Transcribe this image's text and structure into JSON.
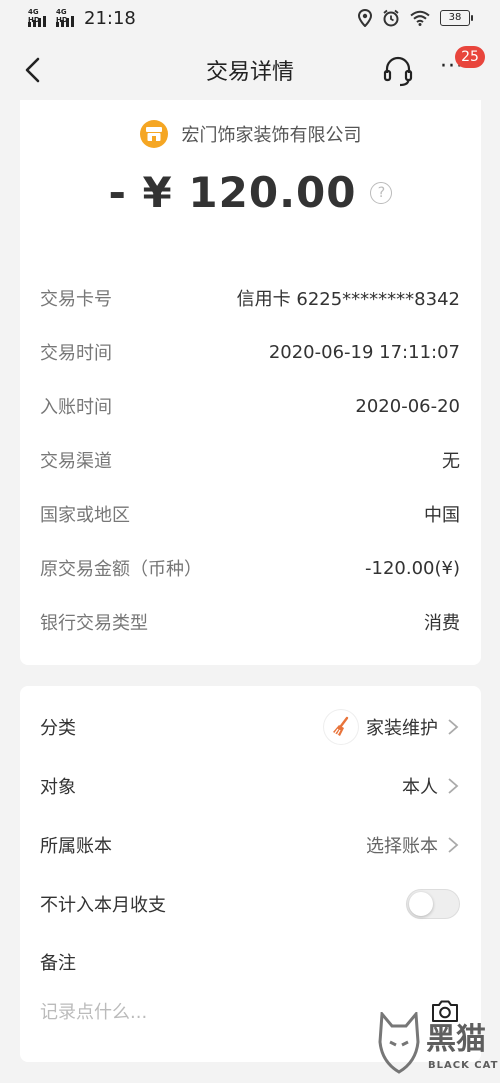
{
  "status_bar": {
    "signal1_tag": "4G HD",
    "signal2_tag": "4G HD",
    "time": "21:18",
    "battery": "38"
  },
  "nav": {
    "title": "交易详情",
    "more_label": "···",
    "badge_count": "25"
  },
  "transaction": {
    "merchant": "宏门饰家装饰有限公司",
    "amount": "- ¥ 120.00",
    "help_glyph": "?",
    "details": [
      {
        "label": "交易卡号",
        "value": "信用卡 6225********8342"
      },
      {
        "label": "交易时间",
        "value": "2020-06-19 17:11:07"
      },
      {
        "label": "入账时间",
        "value": "2020-06-20"
      },
      {
        "label": "交易渠道",
        "value": "无"
      },
      {
        "label": "国家或地区",
        "value": "中国"
      },
      {
        "label": "原交易金额（币种）",
        "value": "-120.00(¥)"
      },
      {
        "label": "银行交易类型",
        "value": "消费"
      }
    ]
  },
  "bookkeeping": {
    "category_label": "分类",
    "category_value": "家装维护",
    "target_label": "对象",
    "target_value": "本人",
    "account_label": "所属账本",
    "account_value": "选择账本",
    "exclude_label": "不计入本月收支",
    "exclude_toggle_on": false,
    "note_label": "备注",
    "note_placeholder": "记录点什么..."
  },
  "watermark": {
    "text": "黑猫",
    "sub": "BLACK CAT"
  },
  "colors": {
    "accent_orange": "#f5a623",
    "badge_red": "#e8453c",
    "category_icon": "#e8743b"
  }
}
